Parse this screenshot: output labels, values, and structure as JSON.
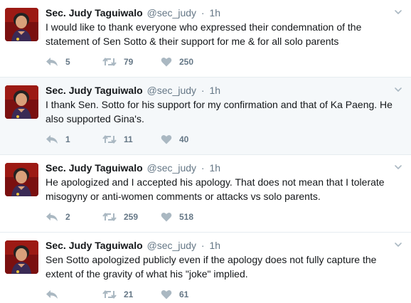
{
  "tweets": [
    {
      "name": "Sec. Judy Taguiwalo",
      "handle": "@sec_judy",
      "time": "1h",
      "text": "I would like to thank everyone who expressed their condemnation of the statement of Sen Sotto & their support for me & for all solo parents",
      "replies": "5",
      "retweets": "79",
      "likes": "250"
    },
    {
      "name": "Sec. Judy Taguiwalo",
      "handle": "@sec_judy",
      "time": "1h",
      "text": "I thank Sen. Sotto for his support for my confirmation and that of Ka Paeng. He also supported Gina's.",
      "replies": "1",
      "retweets": "11",
      "likes": "40"
    },
    {
      "name": "Sec. Judy Taguiwalo",
      "handle": "@sec_judy",
      "time": "1h",
      "text": "He apologized and I accepted his apology. That does not mean that I tolerate misogyny or anti-women comments or attacks vs solo parents.",
      "replies": "2",
      "retweets": "259",
      "likes": "518"
    },
    {
      "name": "Sec. Judy Taguiwalo",
      "handle": "@sec_judy",
      "time": "1h",
      "text": "Sen Sotto apologized publicly even if the apology does not fully capture the extent of the gravity of what his \"joke\" implied.",
      "replies": "",
      "retweets": "21",
      "likes": "61"
    }
  ],
  "separator": "·",
  "icons": {
    "reply": "reply-icon",
    "retweet": "retweet-icon",
    "like": "heart-icon",
    "caret": "chevron-down-icon"
  },
  "colors": {
    "name": "#14171a",
    "meta": "#657786",
    "icon": "#aab8c2",
    "highlight_bg": "#f5f8fa",
    "avatar_bg": "#7a1010"
  }
}
